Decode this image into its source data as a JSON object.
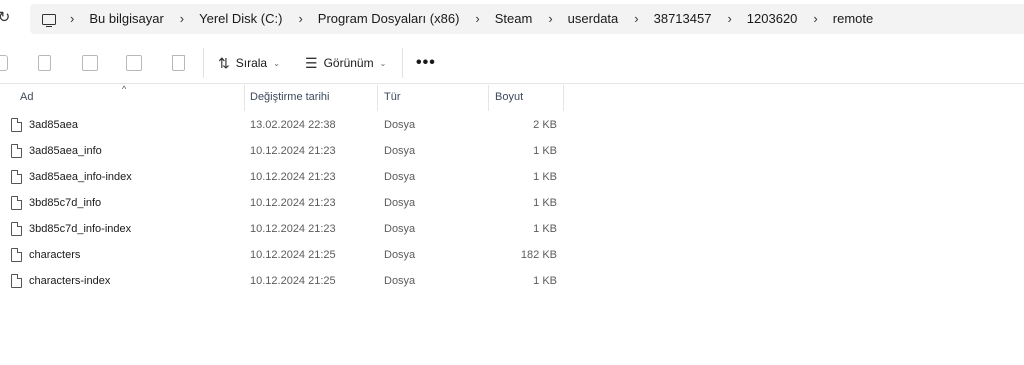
{
  "address": {
    "crumbs": [
      "Bu bilgisayar",
      "Yerel Disk (C:)",
      "Program Dosyaları (x86)",
      "Steam",
      "userdata",
      "38713457",
      "1203620",
      "remote"
    ]
  },
  "toolbar": {
    "sort_label": "Sırala",
    "view_label": "Görünüm",
    "more_label": "•••"
  },
  "columns": {
    "name": "Ad",
    "date": "Değiştirme tarihi",
    "type": "Tür",
    "size": "Boyut"
  },
  "files": [
    {
      "name": "3ad85aea",
      "date": "13.02.2024 22:38",
      "type": "Dosya",
      "size": "2 KB"
    },
    {
      "name": "3ad85aea_info",
      "date": "10.12.2024 21:23",
      "type": "Dosya",
      "size": "1 KB"
    },
    {
      "name": "3ad85aea_info-index",
      "date": "10.12.2024 21:23",
      "type": "Dosya",
      "size": "1 KB"
    },
    {
      "name": "3bd85c7d_info",
      "date": "10.12.2024 21:23",
      "type": "Dosya",
      "size": "1 KB"
    },
    {
      "name": "3bd85c7d_info-index",
      "date": "10.12.2024 21:23",
      "type": "Dosya",
      "size": "1 KB"
    },
    {
      "name": "characters",
      "date": "10.12.2024 21:25",
      "type": "Dosya",
      "size": "182 KB"
    },
    {
      "name": "characters-index",
      "date": "10.12.2024 21:25",
      "type": "Dosya",
      "size": "1 KB"
    }
  ]
}
